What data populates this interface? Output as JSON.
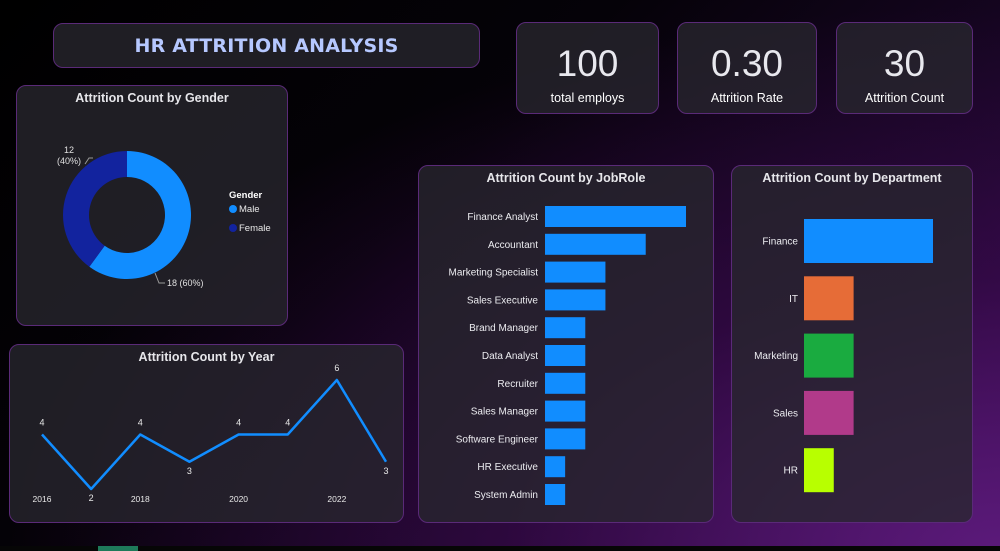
{
  "header": {
    "title": "HR ATTRITION ANALYSIS"
  },
  "kpis": [
    {
      "value": "100",
      "label": "total employs"
    },
    {
      "value": "0.30",
      "label": "Attrition Rate"
    },
    {
      "value": "30",
      "label": "Attrition Count"
    }
  ],
  "colors": {
    "accent_blue": "#118dff",
    "dark_blue": "#12239e",
    "orange": "#e66c37",
    "green": "#1aab40",
    "magenta": "#b13a8a",
    "lime": "#b8ff00",
    "title_text": "#b6c8ff"
  },
  "chart_data": [
    {
      "type": "pie",
      "title": "Attrition Count by Gender",
      "legend_title": "Gender",
      "legend_position": "right",
      "categories": [
        "Male",
        "Female"
      ],
      "values": [
        18,
        12
      ],
      "data_labels": [
        "18 (60%)",
        "12 (40%)"
      ],
      "colors": [
        "#118dff",
        "#12239e"
      ]
    },
    {
      "type": "line",
      "title": "Attrition Count by Year",
      "x": [
        2016,
        2017,
        2018,
        2019,
        2020,
        2021,
        2022,
        2023
      ],
      "tick_labels": [
        "2016",
        "2018",
        "2020",
        "2022"
      ],
      "series": [
        {
          "values": [
            4,
            2,
            4,
            3,
            4,
            4,
            6,
            3
          ]
        }
      ],
      "ylim": [
        2,
        6
      ]
    },
    {
      "type": "bar",
      "orientation": "horizontal",
      "title": "Attrition Count by JobRole",
      "categories": [
        "Finance Analyst",
        "Accountant",
        "Marketing Specialist",
        "Sales Executive",
        "Brand Manager",
        "Data Analyst",
        "Recruiter",
        "Sales Manager",
        "Software Engineer",
        "HR Executive",
        "System Admin"
      ],
      "values": [
        7,
        5,
        3,
        3,
        2,
        2,
        2,
        2,
        2,
        1,
        1
      ],
      "xlim": [
        0,
        7
      ],
      "color": "#118dff"
    },
    {
      "type": "bar",
      "orientation": "horizontal",
      "title": "Attrition Count by Department",
      "categories": [
        "Finance",
        "IT",
        "Marketing",
        "Sales",
        "HR"
      ],
      "values": [
        13,
        5,
        5,
        5,
        3
      ],
      "xlim": [
        0,
        13
      ],
      "colors": [
        "#118dff",
        "#e66c37",
        "#1aab40",
        "#b13a8a",
        "#b8ff00"
      ]
    }
  ]
}
